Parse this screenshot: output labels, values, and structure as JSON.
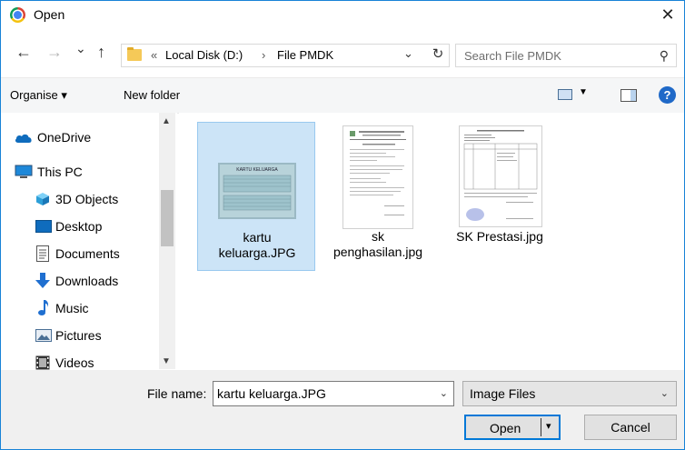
{
  "window": {
    "title": "Open",
    "close_glyph": "✕"
  },
  "nav": {
    "back_glyph": "←",
    "forward_glyph": "→",
    "recent_glyph": "⌄",
    "up_glyph": "↑",
    "breadcrumb": {
      "overflow": "«",
      "separator": "›",
      "items": [
        "Local Disk (D:)",
        "File PMDK"
      ]
    },
    "address_dropdown_glyph": "⌄",
    "refresh_glyph": "↻",
    "search_placeholder": "Search File PMDK",
    "search_icon": "⚲"
  },
  "toolbar": {
    "organise": "Organise ▾",
    "new_folder": "New folder",
    "help": "?",
    "view_dropdown": "▼"
  },
  "sidebar": {
    "items": [
      {
        "label": "OneDrive",
        "icon": "cloud-icon"
      },
      {
        "label": "This PC",
        "icon": "computer-icon"
      },
      {
        "label": "3D Objects",
        "icon": "cube-icon"
      },
      {
        "label": "Desktop",
        "icon": "desktop-icon"
      },
      {
        "label": "Documents",
        "icon": "document-icon"
      },
      {
        "label": "Downloads",
        "icon": "download-icon"
      },
      {
        "label": "Music",
        "icon": "music-icon"
      },
      {
        "label": "Pictures",
        "icon": "pictures-icon"
      },
      {
        "label": "Videos",
        "icon": "video-icon"
      }
    ],
    "scroll_up": "▲",
    "scroll_down": "▼"
  },
  "files": [
    {
      "name": "kartu keluarga.JPG",
      "line1": "kartu",
      "line2": "keluarga.JPG",
      "selected": true,
      "thumb_heading": "KARTU KELUARGA"
    },
    {
      "name": "sk penghasilan.jpg",
      "line1": "sk",
      "line2": "penghasilan.jpg",
      "selected": false
    },
    {
      "name": "SK Prestasi.jpg",
      "line1": "SK Prestasi.jpg",
      "line2": "",
      "selected": false
    }
  ],
  "footer": {
    "file_name_label": "File name:",
    "file_name_value": "kartu keluarga.JPG",
    "file_type": "Image Files",
    "dropdown_glyph": "⌄",
    "open_label": "Open",
    "open_split_glyph": "▾",
    "cancel_label": "Cancel"
  },
  "colors": {
    "accent": "#0078d7",
    "selection": "#cce4f7",
    "toolbar_bg": "#f5f6f7",
    "footer_bg": "#f0f0f0"
  }
}
